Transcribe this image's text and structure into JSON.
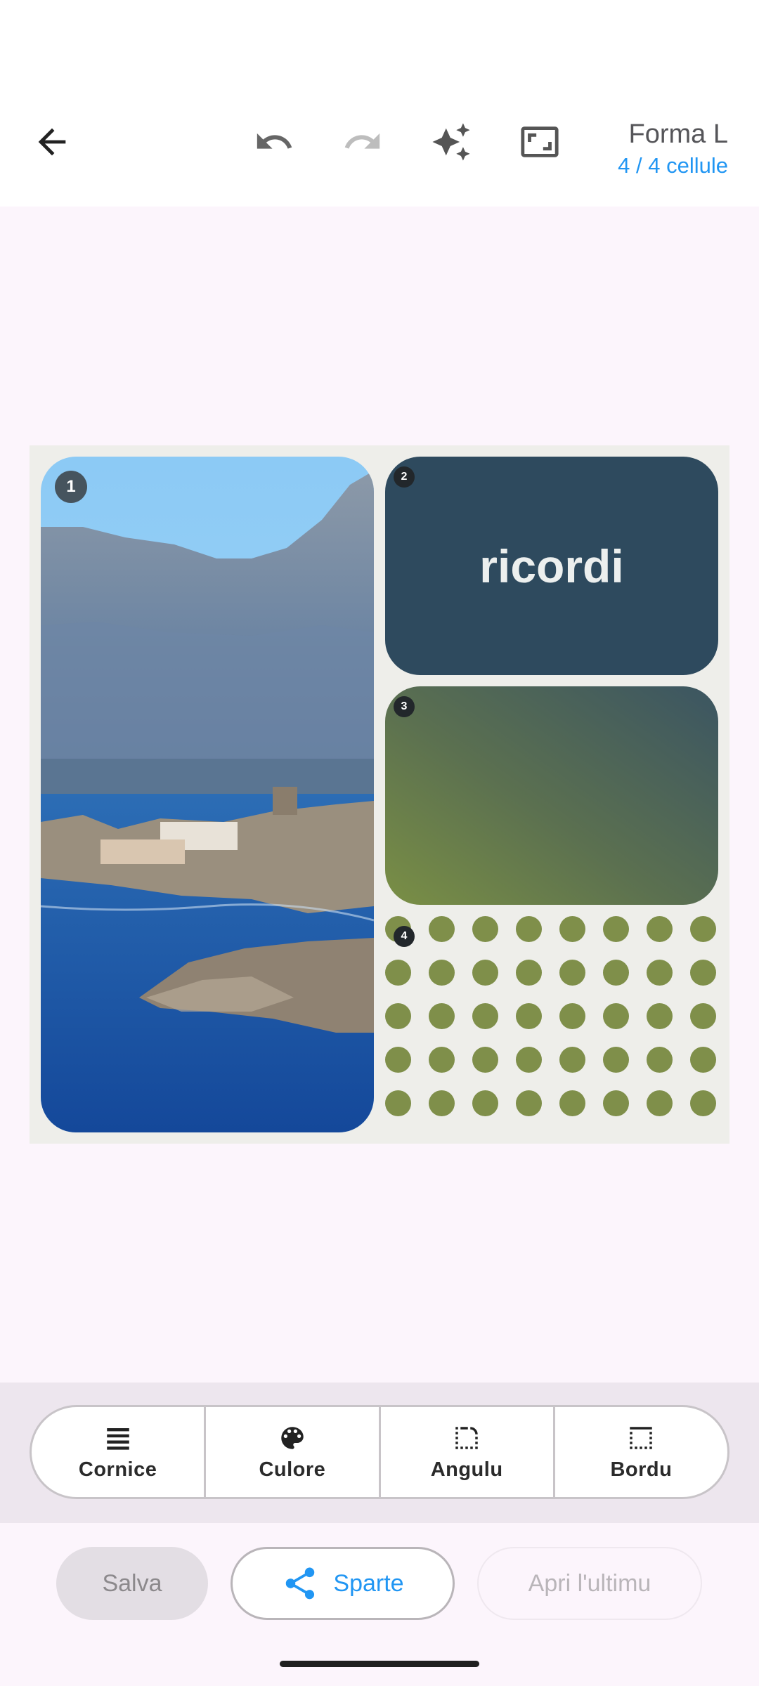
{
  "toolbar": {
    "back_icon": "arrow-back-icon",
    "undo_icon": "undo-icon",
    "redo_icon": "redo-icon",
    "magic_icon": "auto-awesome-icon",
    "fit_icon": "aspect-ratio-icon",
    "title": "Forma L",
    "subtitle": "4 / 4 cellule"
  },
  "collage": {
    "background": "#eeeeea",
    "cells": [
      {
        "index": "1",
        "content": "photo"
      },
      {
        "index": "2",
        "content": "text",
        "text": "ricordi",
        "color": "#2e4a5e"
      },
      {
        "index": "3",
        "content": "gradient",
        "colors": [
          "#7a8f45",
          "#3b5562"
        ]
      },
      {
        "index": "4",
        "content": "dot-pattern",
        "color": "#7f8f4a"
      }
    ]
  },
  "tools": [
    {
      "label": "Cornice",
      "icon": "frame-lines-icon"
    },
    {
      "label": "Culore",
      "icon": "palette-icon"
    },
    {
      "label": "Angulu",
      "icon": "rounded-corner-icon"
    },
    {
      "label": "Bordu",
      "icon": "border-icon"
    }
  ],
  "actions": {
    "save": "Salva",
    "share": "Sparte",
    "open_last": "Apri l'ultimu"
  }
}
